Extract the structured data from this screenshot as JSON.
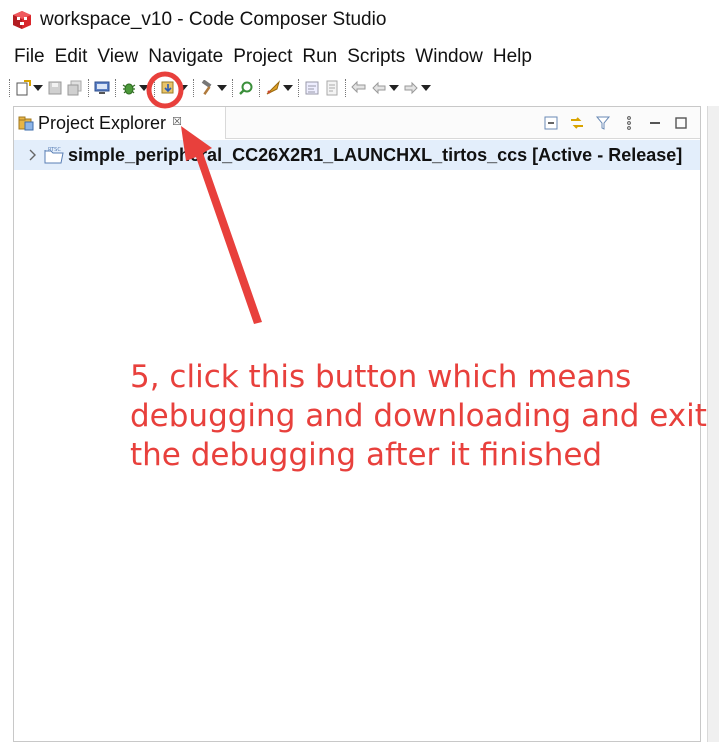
{
  "window": {
    "title": "workspace_v10 - Code Composer Studio"
  },
  "menu": [
    "File",
    "Edit",
    "View",
    "Navigate",
    "Project",
    "Run",
    "Scripts",
    "Window",
    "Help"
  ],
  "project_explorer": {
    "tab_label": "Project Explorer",
    "tab_close": "☒",
    "project_label": "simple_peripheral_CC26X2R1_LAUNCHXL_tirtos_ccs  [Active - Release]"
  },
  "annotation": {
    "text": "5, click this button which means debugging and downloading and exit the debugging after it finished",
    "color": "#e8403c"
  },
  "colors": {
    "selection": "#e3eefb",
    "accent_red": "#e8403c"
  }
}
